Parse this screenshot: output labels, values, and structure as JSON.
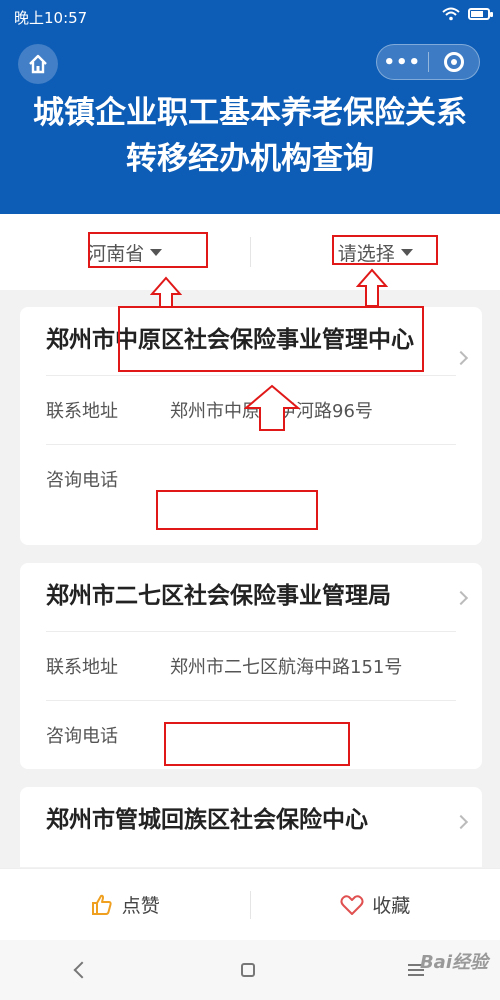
{
  "status": {
    "time": "晚上10:57",
    "battery_level": 0.75
  },
  "header": {
    "title": "城镇企业职工基本养老保险关系转移经办机构查询",
    "capsule_menu": "•••"
  },
  "filters": {
    "province": "河南省",
    "city": "请选择"
  },
  "cards": [
    {
      "name": "郑州市中原区社会保险事业管理中心",
      "address_label": "联系地址",
      "address": "郑州市中原区伊河路96号",
      "phone_label": "咨询电话",
      "phone": ""
    },
    {
      "name": "郑州市二七区社会保险事业管理局",
      "address_label": "联系地址",
      "address": "郑州市二七区航海中路151号",
      "phone_label": "咨询电话",
      "phone": ""
    },
    {
      "name": "郑州市管城回族区社会保险中心",
      "address_label": "",
      "address": "",
      "phone_label": "",
      "phone": ""
    }
  ],
  "bottom_bar": {
    "like": "点赞",
    "favorite": "收藏"
  },
  "watermark": "Bai经验",
  "colors": {
    "brand": "#0d5cb6",
    "annotation": "#e01818",
    "like_icon": "#f0a020",
    "favorite_icon": "#e05050"
  }
}
